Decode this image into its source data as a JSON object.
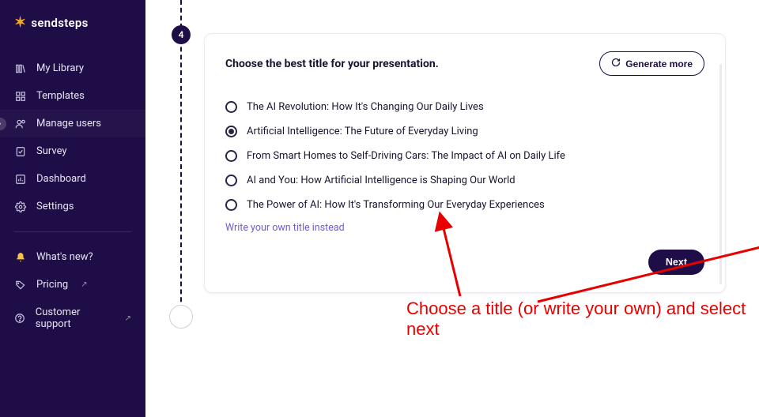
{
  "brand": {
    "name": "sendsteps"
  },
  "sidebar": {
    "items": [
      {
        "label": "My Library"
      },
      {
        "label": "Templates"
      },
      {
        "label": "Manage users"
      },
      {
        "label": "Survey"
      },
      {
        "label": "Dashboard"
      },
      {
        "label": "Settings"
      }
    ],
    "lower": [
      {
        "label": "What's new?"
      },
      {
        "label": "Pricing"
      },
      {
        "label": "Customer support"
      }
    ]
  },
  "step": {
    "number": "4"
  },
  "card": {
    "heading": "Choose the best title for your presentation.",
    "generate_label": "Generate more",
    "options": [
      "The AI Revolution: How It's Changing Our Daily Lives",
      "Artificial Intelligence: The Future of Everyday Living",
      "From Smart Homes to Self-Driving Cars: The Impact of AI on Daily Life",
      "AI and You: How Artificial Intelligence is Shaping Our World",
      "The Power of AI: How It's Transforming Our Everyday Experiences"
    ],
    "selected_index": 1,
    "own_title_link": "Write your own title instead",
    "next_label": "Next"
  },
  "annotation": {
    "text": "Choose a title (or write your own) and select next"
  }
}
